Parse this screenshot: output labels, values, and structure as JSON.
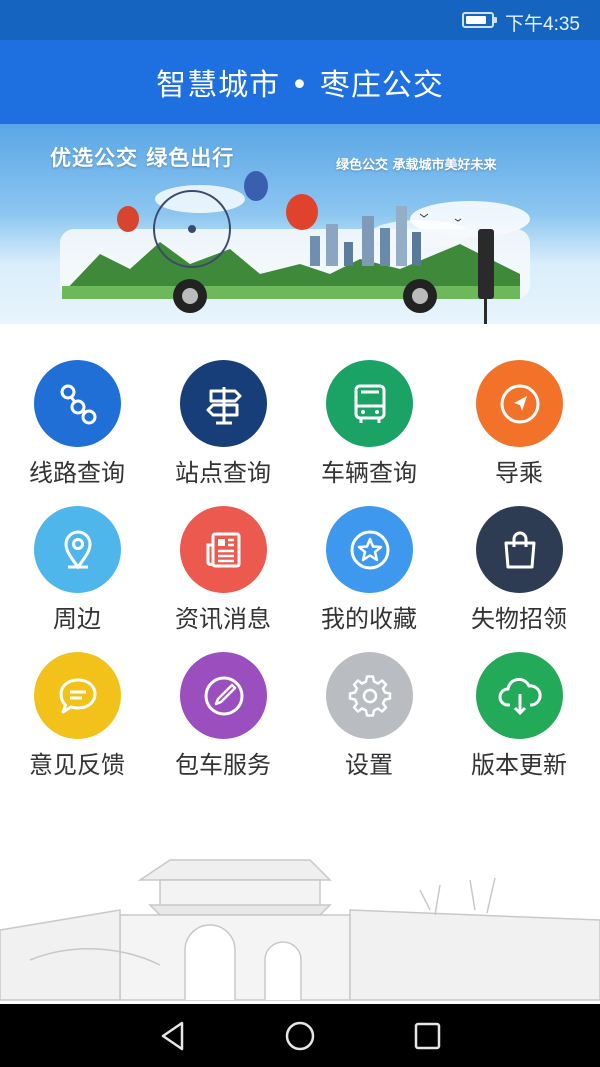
{
  "status_bar": {
    "time": "下午4:35",
    "battery_level": 0.85
  },
  "header": {
    "title": "智慧城市 • 枣庄公交"
  },
  "banner": {
    "slogan_main": "优选公交 绿色出行",
    "slogan_sub": "绿色公交 承载城市美好未来"
  },
  "menu": {
    "items": [
      {
        "label": "线路查询",
        "icon": "route-icon",
        "color": "#1f6fd6"
      },
      {
        "label": "站点查询",
        "icon": "signpost-icon",
        "color": "#173e78"
      },
      {
        "label": "车辆查询",
        "icon": "bus-icon",
        "color": "#1ba366"
      },
      {
        "label": "导乘",
        "icon": "compass-icon",
        "color": "#f2722a"
      },
      {
        "label": "周边",
        "icon": "location-pin-icon",
        "color": "#4fb6ec"
      },
      {
        "label": "资讯消息",
        "icon": "news-icon",
        "color": "#ec5a4f"
      },
      {
        "label": "我的收藏",
        "icon": "star-icon",
        "color": "#3d98ee"
      },
      {
        "label": "失物招领",
        "icon": "bag-icon",
        "color": "#2d3c52"
      },
      {
        "label": "意见反馈",
        "icon": "chat-icon",
        "color": "#f2c21a"
      },
      {
        "label": "包车服务",
        "icon": "edit-icon",
        "color": "#9b4fbf"
      },
      {
        "label": "设置",
        "icon": "gear-icon",
        "color": "#b9bcc1"
      },
      {
        "label": "版本更新",
        "icon": "cloud-download-icon",
        "color": "#22aa58"
      }
    ]
  },
  "nav": {
    "back": "back-icon",
    "home": "home-icon",
    "recent": "recent-apps-icon"
  }
}
